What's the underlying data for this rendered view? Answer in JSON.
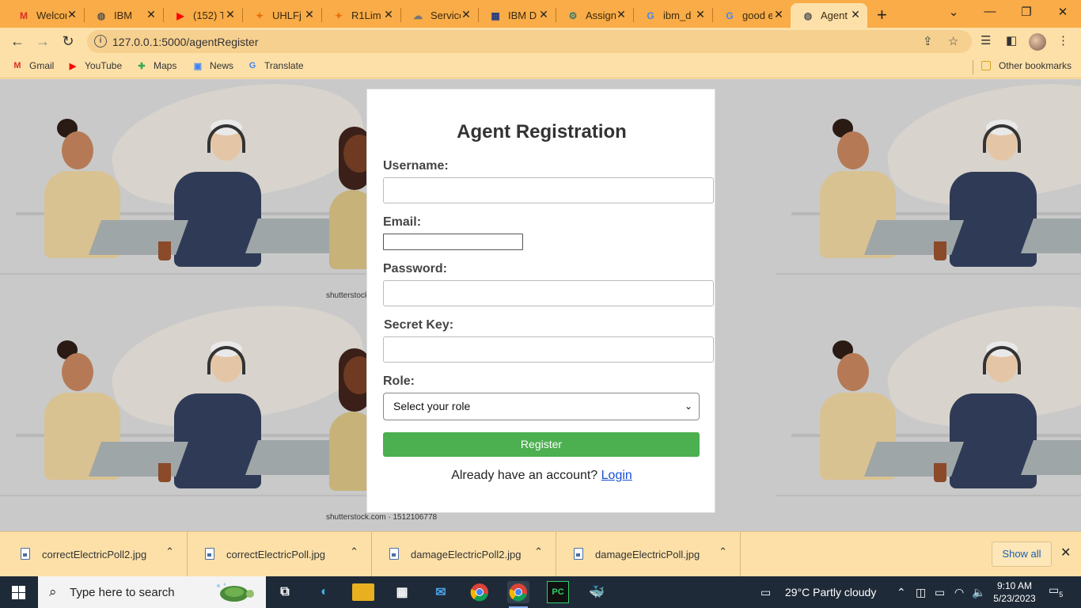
{
  "browser": {
    "tabs": [
      {
        "title": "Welcome",
        "icon": "gmail-icon",
        "color": "#d93025",
        "glyph": "M",
        "active": false
      },
      {
        "title": "IBM",
        "icon": "globe-icon",
        "color": "#555555",
        "glyph": "◍",
        "active": false
      },
      {
        "title": "(152) T",
        "icon": "youtube-icon",
        "color": "#ff0000",
        "glyph": "▶",
        "active": false
      },
      {
        "title": "UHLFj",
        "icon": "pinwheel-icon",
        "color": "#e8710a",
        "glyph": "✦",
        "active": false
      },
      {
        "title": "R1Lim",
        "icon": "pinwheel-icon",
        "color": "#e8710a",
        "glyph": "✦",
        "active": false
      },
      {
        "title": "Service",
        "icon": "cloud-icon",
        "color": "#777777",
        "glyph": "☁",
        "active": false
      },
      {
        "title": "IBM D",
        "icon": "ibm-grid-icon",
        "color": "#1d3a8a",
        "glyph": "▦",
        "active": false
      },
      {
        "title": "Assign",
        "icon": "chatgpt-icon",
        "color": "#3a7a6a",
        "glyph": "⚙",
        "active": false
      },
      {
        "title": "ibm_d",
        "icon": "google-icon",
        "color": "#4285f4",
        "glyph": "G",
        "active": false
      },
      {
        "title": "good e",
        "icon": "google-icon",
        "color": "#4285f4",
        "glyph": "G",
        "active": false
      },
      {
        "title": "Agent",
        "icon": "globe-icon",
        "color": "#555555",
        "glyph": "◍",
        "active": true
      }
    ],
    "url": "127.0.0.1:5000/agentRegister",
    "bookmarks": [
      {
        "label": "Gmail",
        "icon": "gmail-icon",
        "color": "#d93025",
        "glyph": "M"
      },
      {
        "label": "YouTube",
        "icon": "youtube-icon",
        "color": "#ff0000",
        "glyph": "▶"
      },
      {
        "label": "Maps",
        "icon": "maps-icon",
        "color": "#34a853",
        "glyph": "✚"
      },
      {
        "label": "News",
        "icon": "news-icon",
        "color": "#4285f4",
        "glyph": "▣"
      },
      {
        "label": "Translate",
        "icon": "translate-icon",
        "color": "#4285f4",
        "glyph": "G"
      }
    ],
    "other_bookmarks": "Other bookmarks"
  },
  "background": {
    "credit_1": "shutterstock",
    "credit_2": "shutterstock.com · 1512106778"
  },
  "form": {
    "title": "Agent Registration",
    "username_label": "Username:",
    "username_value": "",
    "email_label": "Email:",
    "email_value": "",
    "password_label": "Password:",
    "password_value": "",
    "secret_label": "Secret Key:",
    "secret_value": "",
    "role_label": "Role:",
    "role_selected": "Select your role",
    "register_label": "Register",
    "already_text": "Already have an account?",
    "login_link": "Login",
    "accent": "#4caf50"
  },
  "downloads": {
    "items": [
      "correctElectricPoll2.jpg",
      "correctElectricPoll.jpg",
      "damageElectricPoll2.jpg",
      "damageElectricPoll.jpg"
    ],
    "show_all": "Show all"
  },
  "taskbar": {
    "search_placeholder": "Type here to search",
    "weather": "29°C  Partly cloudy",
    "time": "9:10 AM",
    "date": "5/23/2023",
    "notifications": "5"
  }
}
